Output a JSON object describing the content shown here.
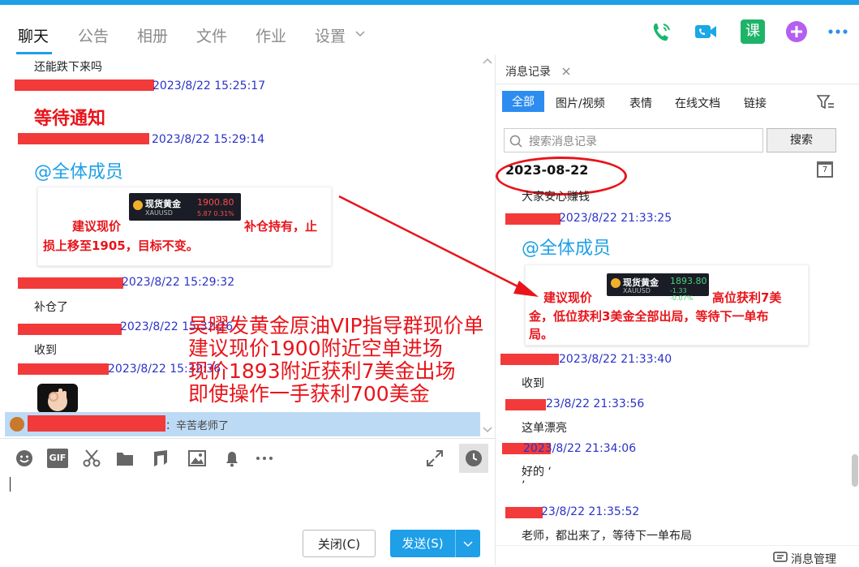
{
  "nav": {
    "tabs": [
      "聊天",
      "公告",
      "相册",
      "文件",
      "作业",
      "设置"
    ],
    "settings_chevron": "chevron-down-icon",
    "icons": [
      "phone-icon",
      "video-call-icon",
      "lesson-icon",
      "add-app-icon",
      "more-icon"
    ],
    "course_glyph": "课"
  },
  "chat": {
    "messages": [
      {
        "text": "还能跌下来吗"
      },
      {
        "time": "2023/8/22 15:25:17",
        "text": "等待通知"
      },
      {
        "time": "2023/8/22 15:29:14",
        "mention": "@全体成员",
        "card": {
          "ticker_name": "现货黄金",
          "ticker_sym": "XAUUSD",
          "ticker_price": "1900.80",
          "ticker_change": "5.87   0.31%",
          "line1a": "建议现价",
          "line1b": "补仓持有，止",
          "line2": "损上移至1905，目标不变。"
        }
      },
      {
        "time": "2023/8/22 15:29:32",
        "text": "补仓了"
      },
      {
        "time": "2023/8/22 15:32:26",
        "text": "收到"
      },
      {
        "time": "2023/8/22 15:32:36"
      }
    ],
    "overlay_lines": [
      "吴曜发黄金原油VIP指导群现价单",
      "建议现价1900附近空单进场",
      "现价1893附近获利7美金出场",
      "即使操作一手获利700美金"
    ],
    "notice_text": "：辛苦老师了"
  },
  "toolbar": {
    "icons": [
      "emoji-icon",
      "gif-icon",
      "scissors-icon",
      "folder-icon",
      "music-icon",
      "image-icon",
      "bell-icon",
      "more-icon",
      "expand-icon",
      "history-icon"
    ],
    "gif_label": "GIF"
  },
  "buttons": {
    "close": "关闭(C)",
    "send": "发送(S)"
  },
  "history": {
    "title": "消息记录",
    "tabs": [
      "全部",
      "图片/视频",
      "表情",
      "在线文档",
      "链接"
    ],
    "search_placeholder": "搜索消息记录",
    "search_button": "搜索",
    "calendar_day": "7",
    "date": "2023-08-22",
    "messages": [
      {
        "text": "大家安心赚钱"
      },
      {
        "time": "2023/8/22 21:33:25",
        "mention": "@全体成员",
        "card": {
          "ticker_name": "现货黄金",
          "ticker_sym": "XAUUSD",
          "ticker_price": "1893.80",
          "ticker_change": "-1.33   -0.07%",
          "line1a": "建议现价",
          "line1b": "高位获利7美",
          "line2": "金，低位获利3美金全部出局，等待下一单布",
          "line3": "局。"
        }
      },
      {
        "time": "2023/8/22 21:33:40",
        "text": "收到"
      },
      {
        "time": "23/8/22 21:33:56",
        "text": "这单漂亮"
      },
      {
        "time": "2023/8/22 21:34:06",
        "text": "好的 ‘",
        "text2": "’"
      },
      {
        "time": "23/8/22 21:35:52",
        "text": "老师，都出来了，等待下一单布局"
      }
    ],
    "footer": "消息管理"
  },
  "colors": {
    "accent": "#1e9fe8",
    "red": "#e8141a",
    "time_blue": "#2b32c8"
  }
}
